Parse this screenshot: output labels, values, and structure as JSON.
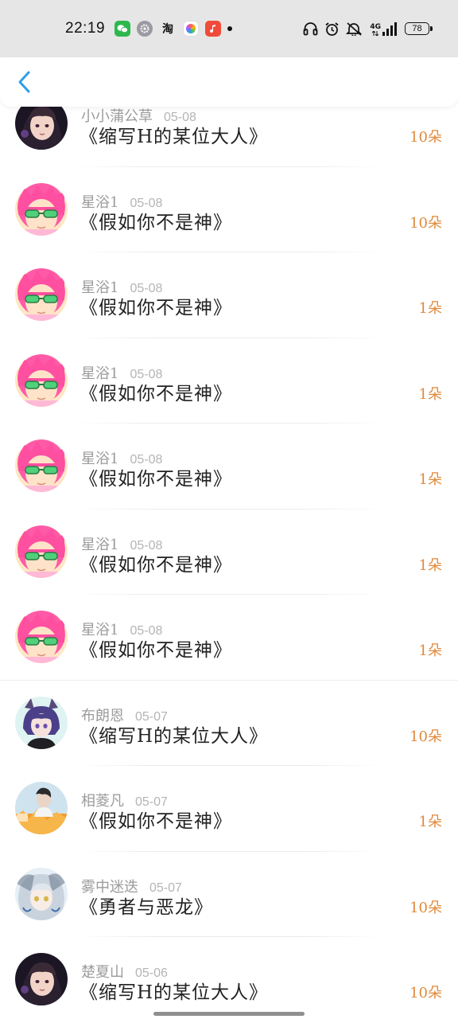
{
  "status_bar": {
    "time": "22:19",
    "network": "4G",
    "battery": "78",
    "app_icons": [
      "wechat-icon",
      "settings-icon",
      "taobao-icon",
      "photos-icon",
      "music-icon"
    ],
    "taobao_glyph": "淘"
  },
  "header": {
    "back_icon": "chevron-left-icon"
  },
  "colors": {
    "accent": "#2f9ee8",
    "count": "#e08a3c",
    "username": "#9b9b9b",
    "date": "#b4b4b4"
  },
  "records": [
    {
      "user": "小小蒲公草",
      "date": "05-08",
      "title": "《缩写H的某位大人》",
      "count": "10朵",
      "avatar": "girl-dark"
    },
    {
      "user": "星浴1",
      "date": "05-08",
      "title": "《假如你不是神》",
      "count": "10朵",
      "avatar": "saiki"
    },
    {
      "user": "星浴1",
      "date": "05-08",
      "title": "《假如你不是神》",
      "count": "1朵",
      "avatar": "saiki"
    },
    {
      "user": "星浴1",
      "date": "05-08",
      "title": "《假如你不是神》",
      "count": "1朵",
      "avatar": "saiki"
    },
    {
      "user": "星浴1",
      "date": "05-08",
      "title": "《假如你不是神》",
      "count": "1朵",
      "avatar": "saiki"
    },
    {
      "user": "星浴1",
      "date": "05-08",
      "title": "《假如你不是神》",
      "count": "1朵",
      "avatar": "saiki"
    },
    {
      "user": "星浴1",
      "date": "05-08",
      "title": "《假如你不是神》",
      "count": "1朵",
      "avatar": "saiki"
    },
    {
      "user": "布朗恩",
      "date": "05-07",
      "title": "《缩写H的某位大人》",
      "count": "10朵",
      "avatar": "anime-purple"
    },
    {
      "user": "相菱凡",
      "date": "05-07",
      "title": "《假如你不是神》",
      "count": "1朵",
      "avatar": "photo-orange"
    },
    {
      "user": "雾中迷迭",
      "date": "05-07",
      "title": "《勇者与恶龙》",
      "count": "10朵",
      "avatar": "anime-silver"
    },
    {
      "user": "楚夏山",
      "date": "05-06",
      "title": "《缩写H的某位大人》",
      "count": "10朵",
      "avatar": "girl-dark"
    }
  ]
}
